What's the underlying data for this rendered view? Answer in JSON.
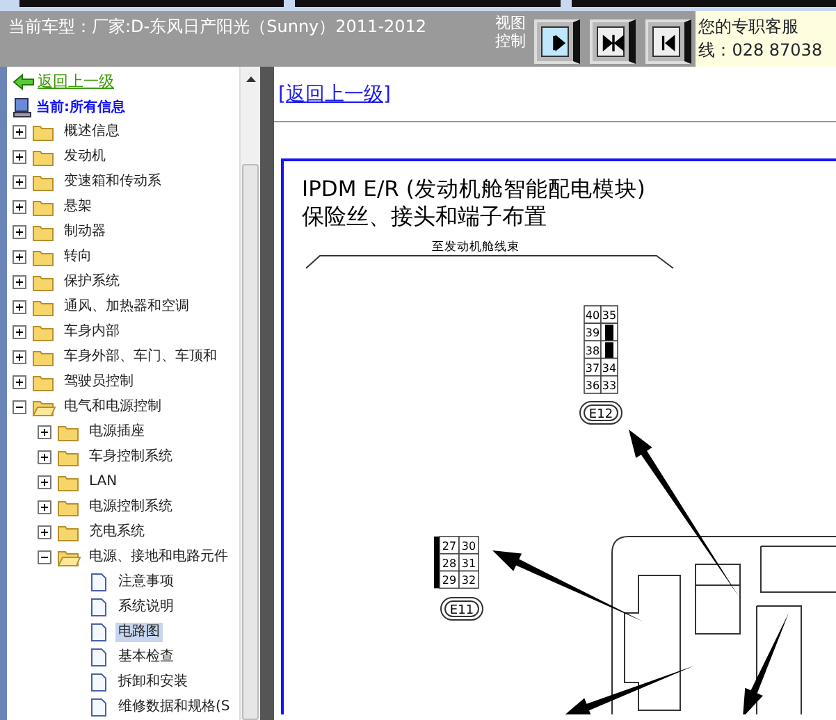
{
  "header": {
    "vehicle": "当前车型：厂家:D-东风日产阳光（Sunny）2011-2012",
    "view_label": "视图控制",
    "view_buttons": [
      {
        "kind": "right",
        "selected": true
      },
      {
        "kind": "both",
        "selected": false
      },
      {
        "kind": "left",
        "selected": false
      }
    ],
    "service_lines": [
      "您的专职客服",
      "线：028 87038"
    ]
  },
  "tree": {
    "back_link": "返回上一级",
    "current": "当前:所有信息",
    "items": [
      {
        "label": "概述信息",
        "kind": "folder",
        "expanded": false,
        "selected": false
      },
      {
        "label": "发动机",
        "kind": "folder",
        "expanded": false,
        "selected": false
      },
      {
        "label": "变速箱和传动系",
        "kind": "folder",
        "expanded": false,
        "selected": false
      },
      {
        "label": "悬架",
        "kind": "folder",
        "expanded": false,
        "selected": false
      },
      {
        "label": "制动器",
        "kind": "folder",
        "expanded": false,
        "selected": false
      },
      {
        "label": "转向",
        "kind": "folder",
        "expanded": false,
        "selected": false
      },
      {
        "label": "保护系统",
        "kind": "folder",
        "expanded": false,
        "selected": false
      },
      {
        "label": "通风、加热器和空调",
        "kind": "folder",
        "expanded": false,
        "selected": false
      },
      {
        "label": "车身内部",
        "kind": "folder",
        "expanded": false,
        "selected": false
      },
      {
        "label": "车身外部、车门、车顶和",
        "kind": "folder",
        "expanded": false,
        "selected": false
      },
      {
        "label": "驾驶员控制",
        "kind": "folder",
        "expanded": false,
        "selected": false
      },
      {
        "label": "电气和电源控制",
        "kind": "folder",
        "expanded": true,
        "selected": false,
        "children": [
          {
            "label": "电源插座",
            "kind": "folder",
            "expanded": false,
            "selected": false
          },
          {
            "label": "车身控制系统",
            "kind": "folder",
            "expanded": false,
            "selected": false
          },
          {
            "label": "LAN",
            "kind": "folder",
            "expanded": false,
            "selected": false
          },
          {
            "label": "电源控制系统",
            "kind": "folder",
            "expanded": false,
            "selected": false
          },
          {
            "label": "充电系统",
            "kind": "folder",
            "expanded": false,
            "selected": false
          },
          {
            "label": "电源、接地和电路元件",
            "kind": "folder",
            "expanded": true,
            "selected": false,
            "children": [
              {
                "label": "注意事项",
                "kind": "page",
                "selected": false
              },
              {
                "label": "系统说明",
                "kind": "page",
                "selected": false
              },
              {
                "label": "电路图",
                "kind": "page",
                "selected": true
              },
              {
                "label": "基本检查",
                "kind": "page",
                "selected": false
              },
              {
                "label": "拆卸和安装",
                "kind": "page",
                "selected": false
              },
              {
                "label": "维修数据和规格(S",
                "kind": "page",
                "selected": false
              }
            ]
          }
        ]
      }
    ]
  },
  "content": {
    "back_link": "[返回上一级]",
    "diagram": {
      "title_lines": [
        "IPDM E/R (发动机舱智能配电模块)",
        "保险丝、接头和端子布置"
      ],
      "harness_label": "至发动机舱线束",
      "connectors": [
        {
          "label": "E12",
          "left_bar": false,
          "rows": [
            {
              "pins": [
                "40",
                "35"
              ]
            },
            {
              "pins": [
                "39"
              ]
            },
            {
              "pins": [
                "38"
              ]
            },
            {
              "pins": [
                "37",
                "34"
              ]
            },
            {
              "pins": [
                "36",
                "33"
              ]
            }
          ]
        },
        {
          "label": "E11",
          "left_bar": true,
          "rows": [
            {
              "pins": [
                "27",
                "30"
              ]
            },
            {
              "pins": [
                "28",
                "31"
              ]
            },
            {
              "pins": [
                "29",
                "32"
              ]
            }
          ]
        }
      ]
    }
  }
}
